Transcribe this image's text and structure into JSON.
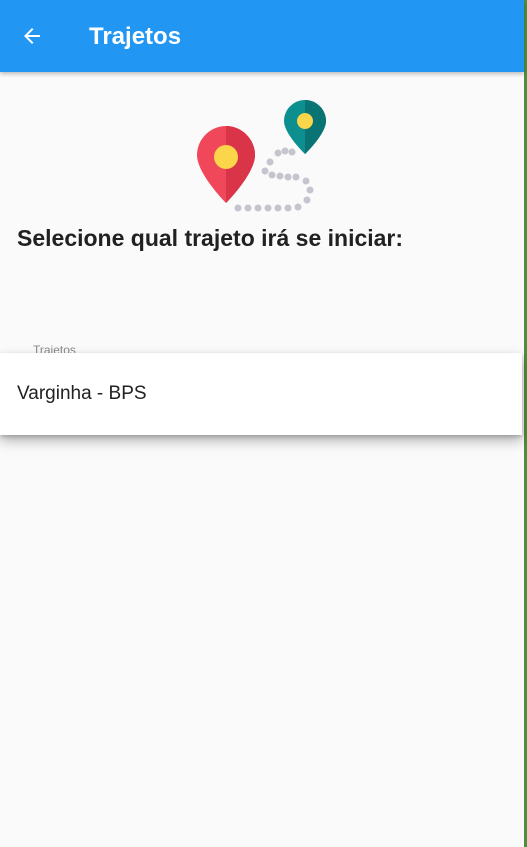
{
  "appbar": {
    "title": "Trajetos",
    "back_icon": "arrow-left-icon",
    "background_color": "#2196f3"
  },
  "illustration": {
    "icon": "route-map-pins-icon"
  },
  "main": {
    "heading": "Selecione qual trajeto irá se iniciar:"
  },
  "route_select": {
    "label": "Trajetos",
    "options": [
      {
        "label": "Varginha - BPS"
      }
    ]
  }
}
